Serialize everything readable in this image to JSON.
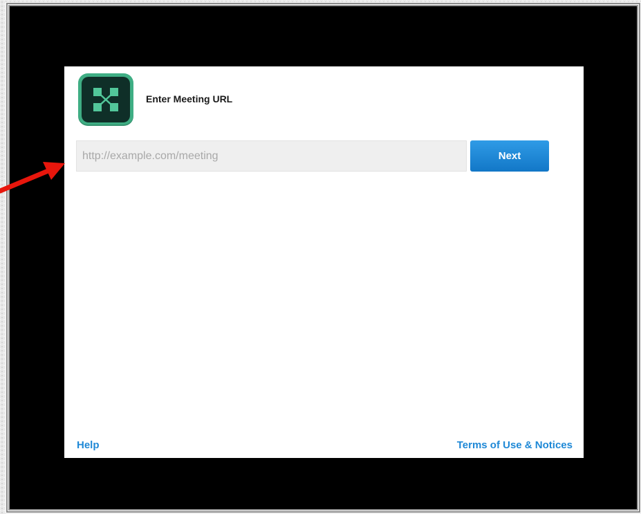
{
  "header": {
    "title": "Enter Meeting URL",
    "logo_icon": "adobe-connect-logo"
  },
  "form": {
    "url_placeholder": "http://example.com/meeting",
    "url_value": "",
    "next_label": "Next"
  },
  "footer": {
    "help_label": "Help",
    "terms_label": "Terms of Use & Notices"
  },
  "colors": {
    "accent": "#1e88d6",
    "button": "#1a86d8",
    "logo_bg": "#3fae84",
    "logo_inner": "#0f2f28",
    "annotation": "#e8160c"
  }
}
